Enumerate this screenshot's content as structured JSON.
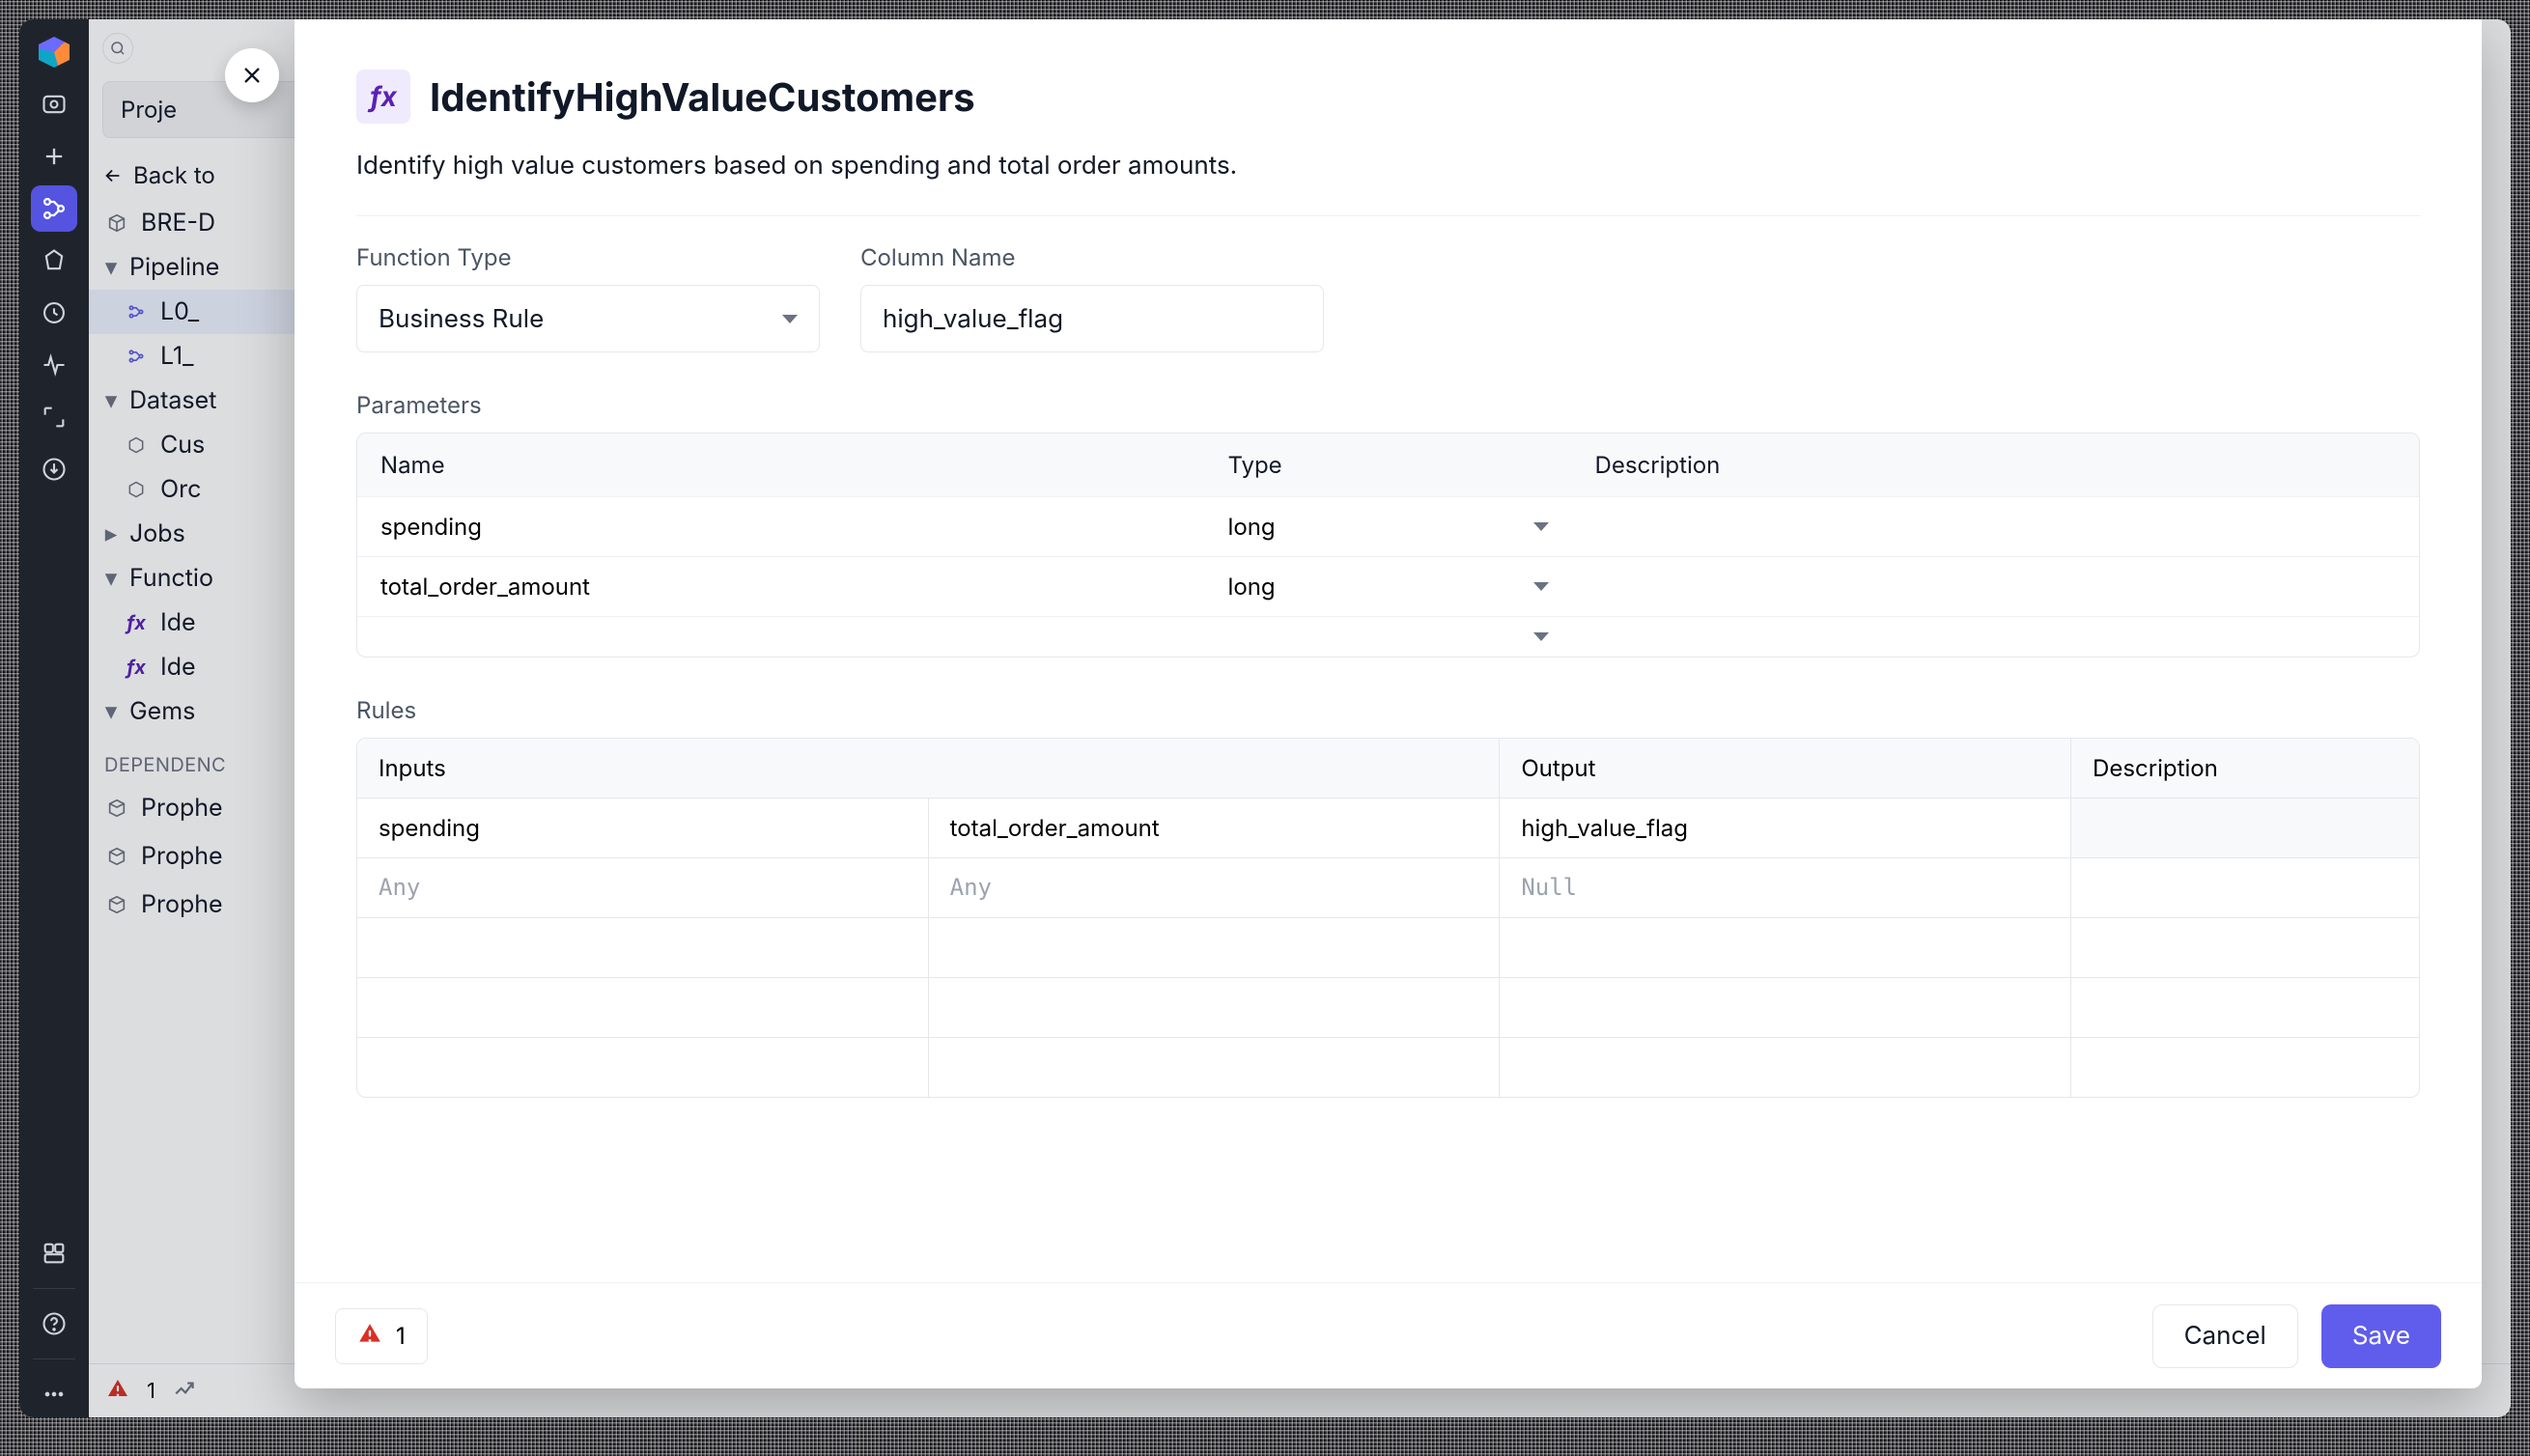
{
  "rail": {
    "active_index": 2
  },
  "sidebar": {
    "project_button": "Proje",
    "back": "Back to",
    "project_node": "BRE-D",
    "groups": {
      "pipelines": {
        "label": "Pipeline",
        "items": [
          "L0_",
          "L1_"
        ]
      },
      "datasets": {
        "label": "Dataset",
        "items": [
          "Cus",
          "Orc"
        ]
      },
      "jobs": {
        "label": "Jobs"
      },
      "functions": {
        "label": "Functio",
        "items": [
          "Ide",
          "Ide"
        ]
      },
      "gems": {
        "label": "Gems"
      }
    },
    "dependencies": {
      "heading": "DEPENDENC",
      "items": [
        "Prophe",
        "Prophe",
        "Prophe"
      ]
    }
  },
  "status": {
    "warnings": "1"
  },
  "modal": {
    "title": "IdentifyHighValueCustomers",
    "description": "Identify high value customers based on spending and total order amounts.",
    "function_type_label": "Function Type",
    "function_type_value": "Business Rule",
    "column_name_label": "Column Name",
    "column_name_value": "high_value_flag",
    "parameters_label": "Parameters",
    "param_headers": {
      "name": "Name",
      "type": "Type",
      "description": "Description"
    },
    "parameters": [
      {
        "name": "spending",
        "type": "long",
        "description": ""
      },
      {
        "name": "total_order_amount",
        "type": "long",
        "description": ""
      },
      {
        "name": "",
        "type": "",
        "description": ""
      }
    ],
    "rules_label": "Rules",
    "rules_headers": {
      "inputs": "Inputs",
      "output": "Output",
      "description": "Description"
    },
    "rules_subheaders": {
      "spending": "spending",
      "total": "total_order_amount",
      "flag": "high_value_flag"
    },
    "rules_rows": [
      {
        "spending": "Any",
        "total": "Any",
        "flag": "Null",
        "description": ""
      }
    ],
    "footer": {
      "warning_count": "1",
      "cancel": "Cancel",
      "save": "Save"
    }
  }
}
